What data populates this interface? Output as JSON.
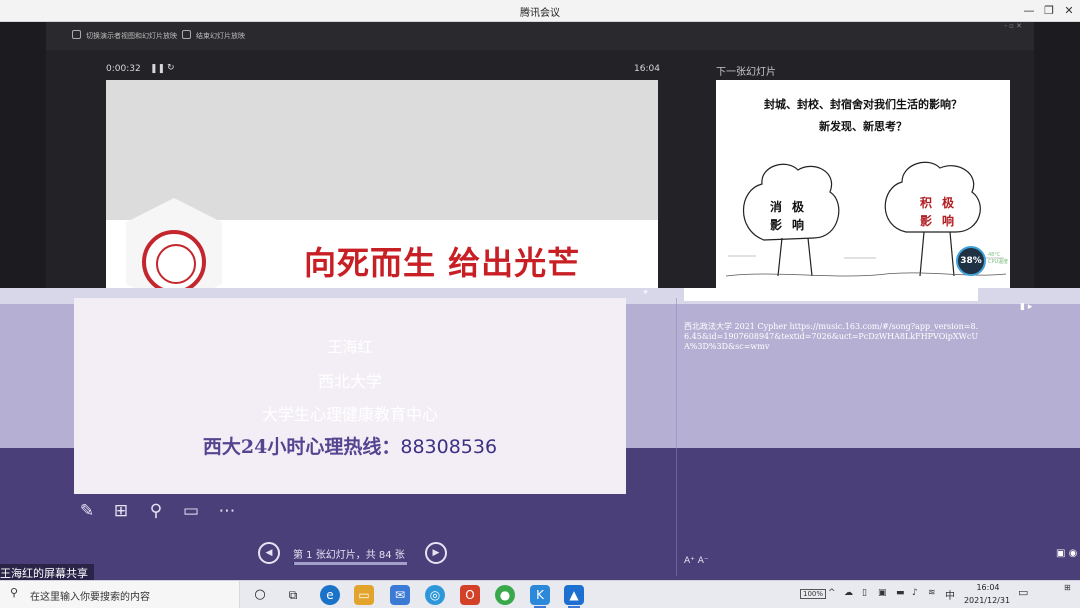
{
  "window": {
    "title": "腾讯会议"
  },
  "presenter": {
    "toolbar": [
      "切换演示者视图和幻灯片放映",
      "结束幻灯片放映"
    ],
    "timer": "0:00:32",
    "clock": "16:04",
    "current_slide": {
      "heading": "向死而生 给出光芒"
    },
    "next_label": "下一张幻灯片",
    "next_slide": {
      "question_line1": "封城、封校、封宿舍对我们生活的影响？",
      "question_line2": "新发现、新思考？",
      "left_tree": [
        "消",
        "极",
        "影",
        "响"
      ],
      "right_tree": [
        "积",
        "极",
        "影",
        "响"
      ]
    },
    "cpu": {
      "percent": "38%",
      "temp": "48°C",
      "label": "CPU温度"
    }
  },
  "lower_view": {
    "slide": {
      "line1": "王海红",
      "line2": "西北大学",
      "line3": "大学生心理健康教育中心",
      "line4_prefix": "西大24小时心理热线：",
      "line4_number": "88308536"
    },
    "notes": "西北政法大学 2021 Cypher https://music.163.com/#/song?app_version=8.6.45&id=1907608947&textid=7026&uct=PcDzWHA8LkFHPVOipXWcUA%3D%3D&sc=wmv",
    "page_indicator": "第 1 张幻灯片，共 84 张",
    "progress": 0.012,
    "share_label": "王海红的屏幕共享"
  },
  "taskbar": {
    "search_placeholder": "在这里输入你要搜索的内容",
    "battery": "100%",
    "ime": "中",
    "time": "16:04",
    "date": "2021/12/31"
  }
}
